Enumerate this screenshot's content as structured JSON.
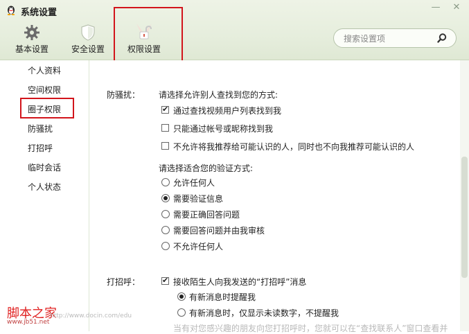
{
  "window": {
    "title": "系统设置",
    "minimize_glyph": "—",
    "close_glyph": "✕"
  },
  "toolbar": {
    "items": [
      {
        "label": "基本设置",
        "icon": "gear-icon"
      },
      {
        "label": "安全设置",
        "icon": "shield-icon"
      },
      {
        "label": "权限设置",
        "icon": "unlock-icon"
      }
    ]
  },
  "search": {
    "placeholder": "搜索设置项",
    "icon": "search-icon"
  },
  "sidebar": {
    "items": [
      {
        "label": "个人资料"
      },
      {
        "label": "空间权限"
      },
      {
        "label": "圈子权限"
      },
      {
        "label": "防骚扰"
      },
      {
        "label": "打招呼"
      },
      {
        "label": "临时会话"
      },
      {
        "label": "个人状态"
      }
    ]
  },
  "anti_harass": {
    "label": "防骚扰：",
    "find_prompt": "请选择允许别人查找到您的方式:",
    "find_options": [
      {
        "label": "通过查找视频用户列表找到我",
        "checked": true
      },
      {
        "label": "只能通过帐号或昵称找到我",
        "checked": false
      },
      {
        "label": "不允许将我推荐给可能认识的人，同时也不向我推荐可能认识的人",
        "checked": false
      }
    ],
    "verify_prompt": "请选择适合您的验证方式:",
    "verify_options": [
      {
        "label": "允许任何人",
        "selected": false
      },
      {
        "label": "需要验证信息",
        "selected": true
      },
      {
        "label": "需要正确回答问题",
        "selected": false
      },
      {
        "label": "需要回答问题并由我审核",
        "selected": false
      },
      {
        "label": "不允许任何人",
        "selected": false
      }
    ]
  },
  "greeting": {
    "label": "打招呼：",
    "receive_option": {
      "label": "接收陌生人向我发送的“打招呼”消息",
      "checked": true
    },
    "notify_options": [
      {
        "label": "有新消息时提醒我",
        "selected": true
      },
      {
        "label": "有新消息时，仅显示未读数字，不提醒我",
        "selected": false
      }
    ],
    "hint": "当有对您感兴趣的朋友向您打招呼时，您就可以在“查找联系人”窗口查看并"
  },
  "watermark": {
    "title": "脚本之家",
    "domain": "www.jb51.net",
    "url": "http://www.docin.com/edu"
  },
  "colors": {
    "highlight": "#d2141b",
    "header_bg": "#e6eedd"
  }
}
